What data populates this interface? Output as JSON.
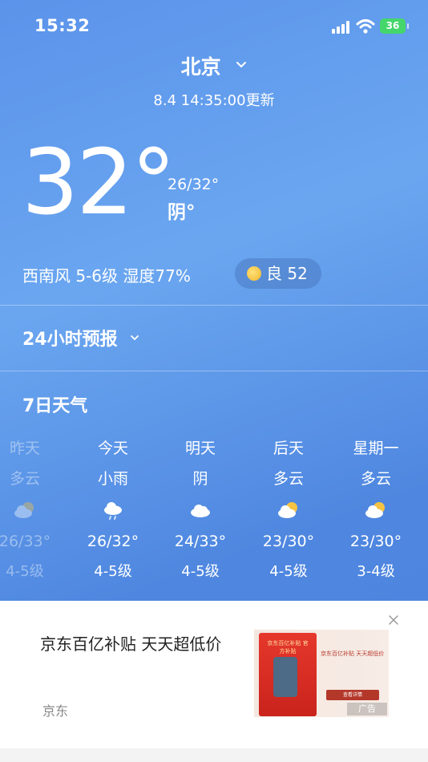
{
  "status_bar": {
    "time": "15:32",
    "battery": "36"
  },
  "header": {
    "city": "北京",
    "updated": "8.4 14:35:00更新"
  },
  "current": {
    "temperature": "32°",
    "range": "26/32°",
    "condition": "阴°",
    "wind_humidity": "西南风 5-6级  湿度77%",
    "aqi": "良 52"
  },
  "sections": {
    "hourly": "24小时预报",
    "daily": "7日天气"
  },
  "daily": [
    {
      "day": "昨天",
      "weather": "多云",
      "icon": "partly-cloudy-icon",
      "temp": "26/33°",
      "wind": "4-5级"
    },
    {
      "day": "今天",
      "weather": "小雨",
      "icon": "light-rain-icon",
      "temp": "26/32°",
      "wind": "4-5级"
    },
    {
      "day": "明天",
      "weather": "阴",
      "icon": "cloudy-icon",
      "temp": "24/33°",
      "wind": "4-5级"
    },
    {
      "day": "后天",
      "weather": "多云",
      "icon": "partly-cloudy-icon",
      "temp": "23/30°",
      "wind": "4-5级"
    },
    {
      "day": "星期一",
      "weather": "多云",
      "icon": "partly-cloudy-icon",
      "temp": "23/30°",
      "wind": "3-4级"
    }
  ],
  "ad": {
    "title": "京东百亿补贴 天天超低价",
    "source": "京东",
    "thumb_text_left": "京东百亿补贴 官方补贴",
    "thumb_text_right": "京东百亿补贴 天天超低价",
    "thumb_button": "查看详情",
    "tag": "广告"
  }
}
